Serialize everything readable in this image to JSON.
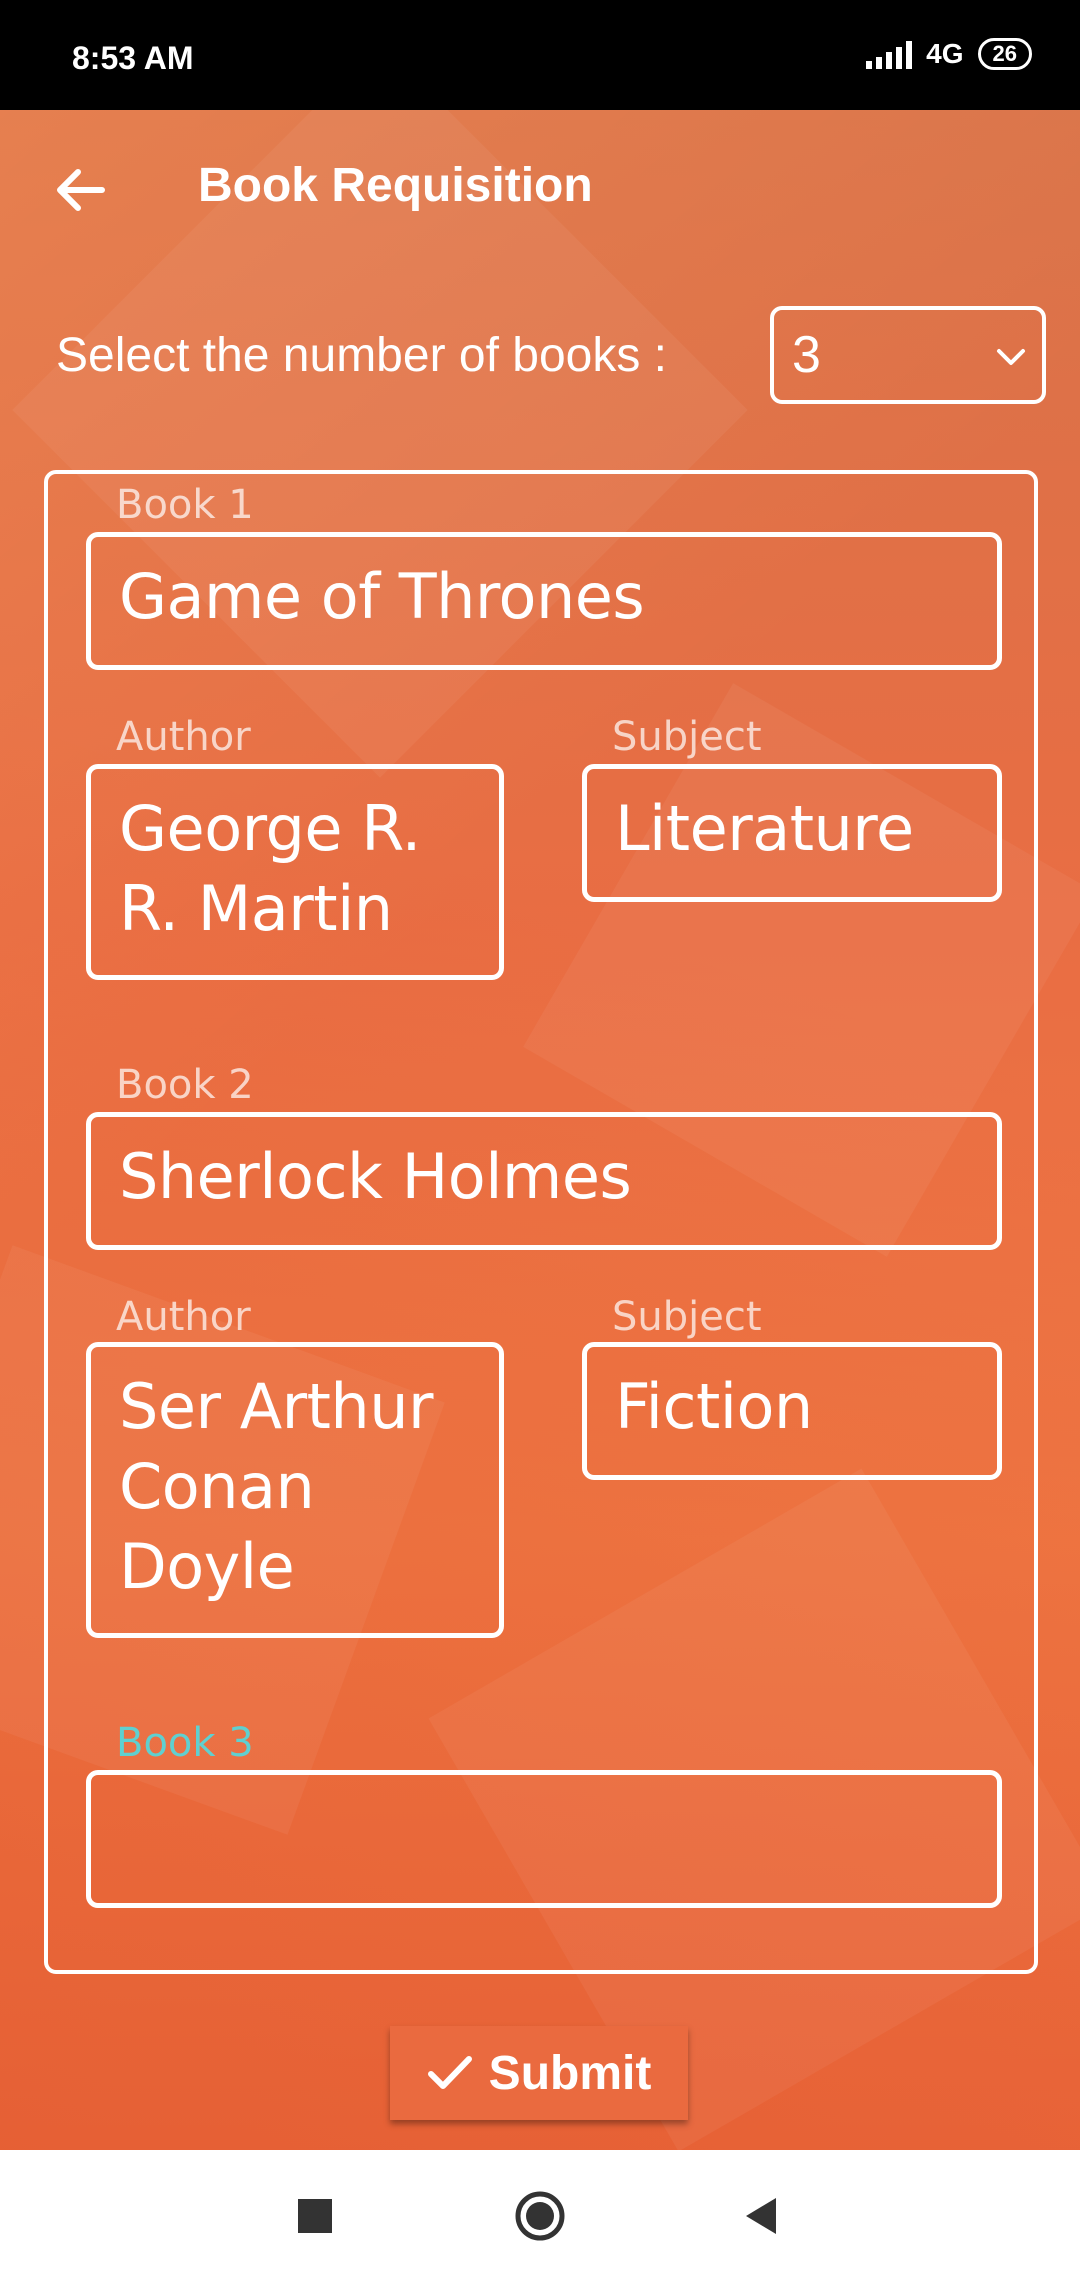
{
  "status_bar": {
    "time": "8:53 AM",
    "network": "4G",
    "battery": "26"
  },
  "header": {
    "title": "Book Requisition"
  },
  "book_count": {
    "label": "Select the number of books :",
    "selected": "3"
  },
  "books": [
    {
      "label": "Book 1",
      "title": "Game of Thrones",
      "author_label": "Author",
      "author_line1": "George R.",
      "author_line2": "R. Martin",
      "subject_label": "Subject",
      "subject": "Literature"
    },
    {
      "label": "Book 2",
      "title": "Sherlock Holmes",
      "author_label": "Author",
      "author_line1": "Ser Arthur",
      "author_line2": "Conan",
      "author_line3": "Doyle",
      "subject_label": "Subject",
      "subject": "Fiction"
    },
    {
      "label": "Book 3",
      "title": ""
    }
  ],
  "submit": {
    "label": "Submit"
  },
  "colors": {
    "background": "#e86a3f",
    "focused_label": "#5fd0d0"
  }
}
